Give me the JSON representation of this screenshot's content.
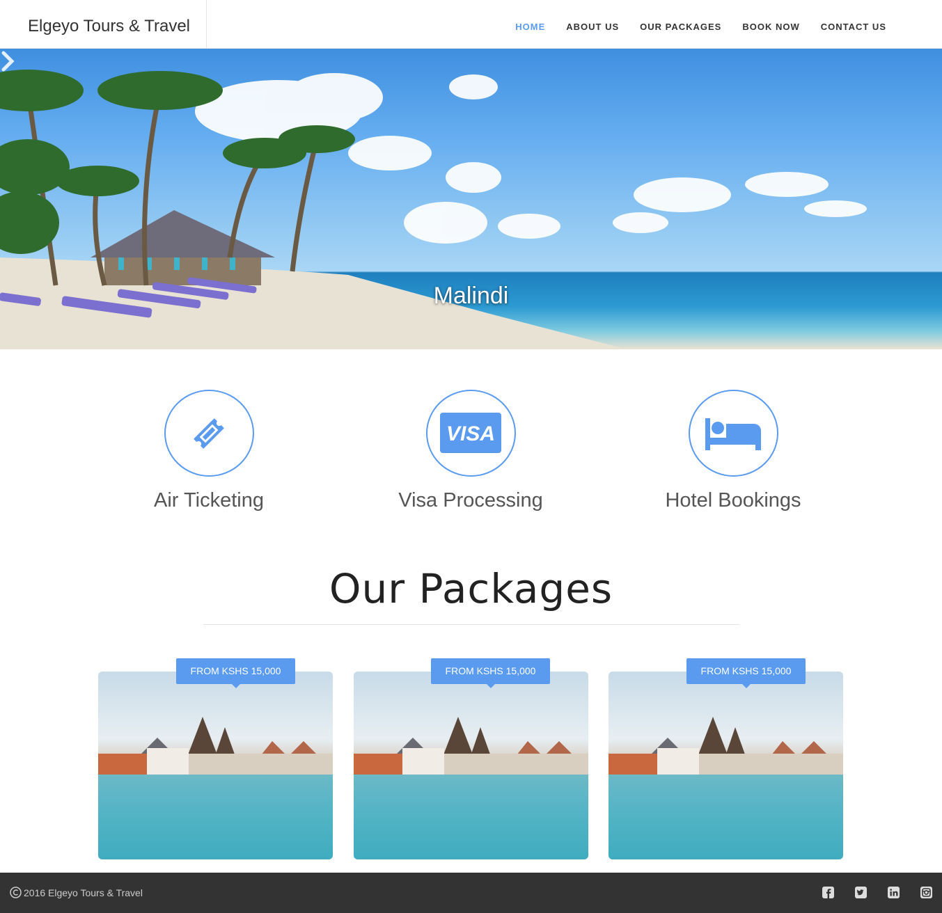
{
  "brand": "Elgeyo Tours & Travel",
  "nav": [
    {
      "label": "HOME",
      "active": true
    },
    {
      "label": "ABOUT US",
      "active": false
    },
    {
      "label": "OUR PACKAGES",
      "active": false
    },
    {
      "label": "BOOK NOW",
      "active": false
    },
    {
      "label": "CONTACT US",
      "active": false
    }
  ],
  "hero": {
    "caption": "Malindi",
    "next_icon": "chevron-right-icon"
  },
  "services": [
    {
      "label": "Air Ticketing",
      "icon": "ticket-icon"
    },
    {
      "label": "Visa Processing",
      "icon": "visa-card-icon"
    },
    {
      "label": "Hotel Bookings",
      "icon": "bed-icon"
    }
  ],
  "packages": {
    "title": "Our Packages",
    "cards": [
      {
        "price": "FROM KSHS 15,000"
      },
      {
        "price": "FROM KSHS 15,000"
      },
      {
        "price": "FROM KSHS 15,000"
      }
    ]
  },
  "footer": {
    "copyright": "2016 Elgeyo Tours & Travel",
    "social": [
      "facebook-icon",
      "twitter-icon",
      "linkedin-icon",
      "instagram-icon"
    ]
  },
  "colors": {
    "accent": "#5a9bf0",
    "footer_bg": "#333333"
  }
}
